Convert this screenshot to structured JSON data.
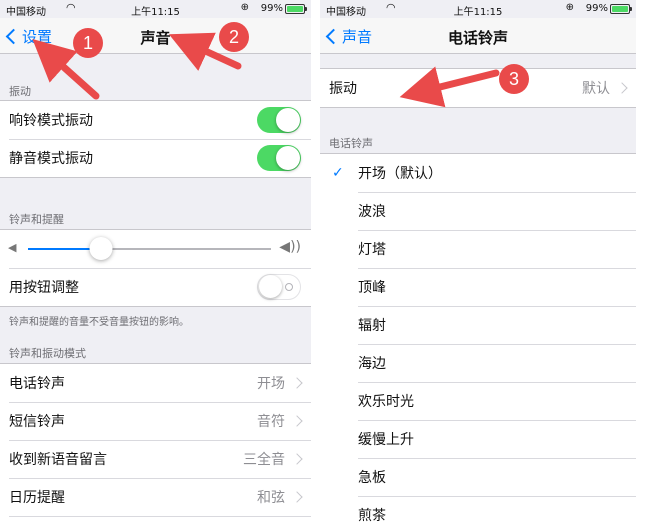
{
  "status": {
    "carrier": "中国移动",
    "time": "上午11:15",
    "battery": "99%",
    "battery_level": 0.99
  },
  "left": {
    "back_label": "设置",
    "title": "声音",
    "vibrate_header": "振动",
    "vibrate_items": [
      {
        "label": "响铃模式振动",
        "on": true
      },
      {
        "label": "静音模式振动",
        "on": true
      }
    ],
    "ringer_header": "铃声和提醒",
    "volume_level": 0.3,
    "change_with_buttons": {
      "label": "用按钮调整",
      "on": false
    },
    "ringer_note": "铃声和提醒的音量不受音量按钮的影响。",
    "patterns_header": "铃声和振动模式",
    "patterns": [
      {
        "label": "电话铃声",
        "value": "开场"
      },
      {
        "label": "短信铃声",
        "value": "音符"
      },
      {
        "label": "收到新语音留言",
        "value": "三全音"
      },
      {
        "label": "日历提醒",
        "value": "和弦"
      }
    ]
  },
  "right": {
    "back_label": "声音",
    "title": "电话铃声",
    "vibration": {
      "label": "振动",
      "value": "默认"
    },
    "ringtones_header": "电话铃声",
    "ringtones": [
      {
        "label": "开场（默认）",
        "selected": true
      },
      {
        "label": "波浪",
        "selected": false
      },
      {
        "label": "灯塔",
        "selected": false
      },
      {
        "label": "顶峰",
        "selected": false
      },
      {
        "label": "辐射",
        "selected": false
      },
      {
        "label": "海边",
        "selected": false
      },
      {
        "label": "欢乐时光",
        "selected": false
      },
      {
        "label": "缓慢上升",
        "selected": false
      },
      {
        "label": "急板",
        "selected": false
      },
      {
        "label": "煎茶",
        "selected": false
      }
    ]
  },
  "annotations": {
    "badges": [
      "1",
      "2",
      "3"
    ],
    "color": "#e94a4a"
  },
  "colors": {
    "accent": "#007aff",
    "toggle_on": "#4cd964",
    "background": "#efeff4"
  }
}
